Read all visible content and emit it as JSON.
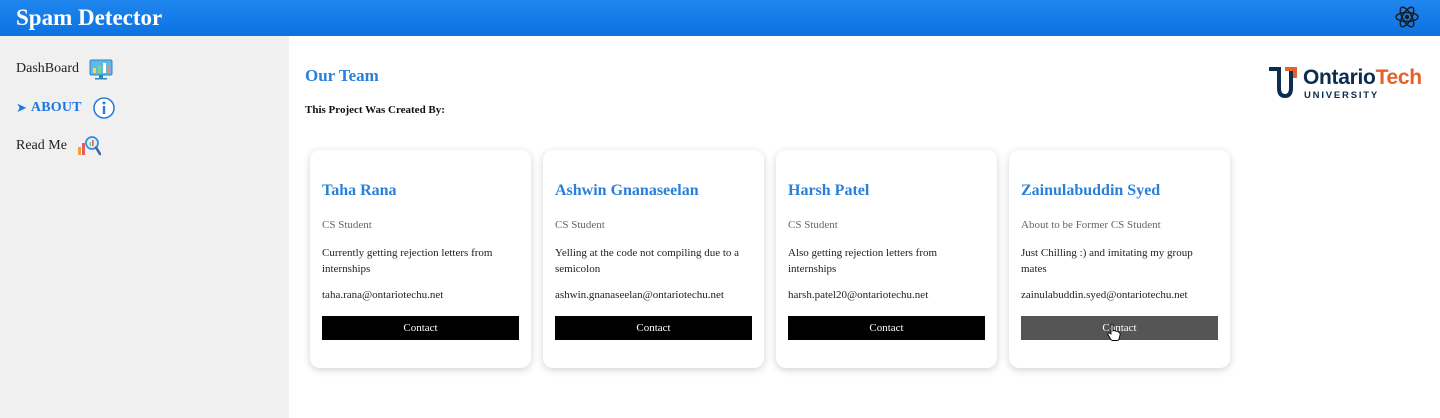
{
  "app": {
    "title": "Spam Detector"
  },
  "sidebar": {
    "items": [
      {
        "label": "DashBoard",
        "icon": "dashboard-monitor-icon",
        "active": false
      },
      {
        "label": "ABOUT",
        "icon": "info-icon",
        "active": true
      },
      {
        "label": "Read Me",
        "icon": "magnifier-chart-icon",
        "active": false
      }
    ]
  },
  "main": {
    "title": "Our Team",
    "subtitle": "This Project Was Created By:",
    "logo": {
      "word_main": "Ontario",
      "word_accent": "Tech",
      "sub": "UNIVERSITY"
    },
    "cards": [
      {
        "name": "Taha Rana",
        "role": "CS Student",
        "desc": "Currently getting rejection letters from internships",
        "email": "taha.rana@ontariotechu.net",
        "button": "Contact"
      },
      {
        "name": "Ashwin Gnanaseelan",
        "role": "CS Student",
        "desc": "Yelling at the code not compiling due to a semicolon",
        "email": "ashwin.gnanaseelan@ontariotechu.net",
        "button": "Contact"
      },
      {
        "name": "Harsh Patel",
        "role": "CS Student",
        "desc": "Also getting rejection letters from internships",
        "email": "harsh.patel20@ontariotechu.net",
        "button": "Contact"
      },
      {
        "name": "Zainulabuddin Syed",
        "role": "About to be Former CS Student",
        "desc": "Just Chilling :) and imitating my group mates",
        "email": "zainulabuddin.syed@ontariotechu.net",
        "button": "Contact"
      }
    ]
  },
  "colors": {
    "header": "#0b72e2",
    "accent": "#2a7fd8",
    "sidebar_bg": "#f0f0f0",
    "button": "#000000",
    "button_hover": "#555555",
    "logo_navy": "#0c2d4e",
    "logo_orange": "#e2622a"
  }
}
